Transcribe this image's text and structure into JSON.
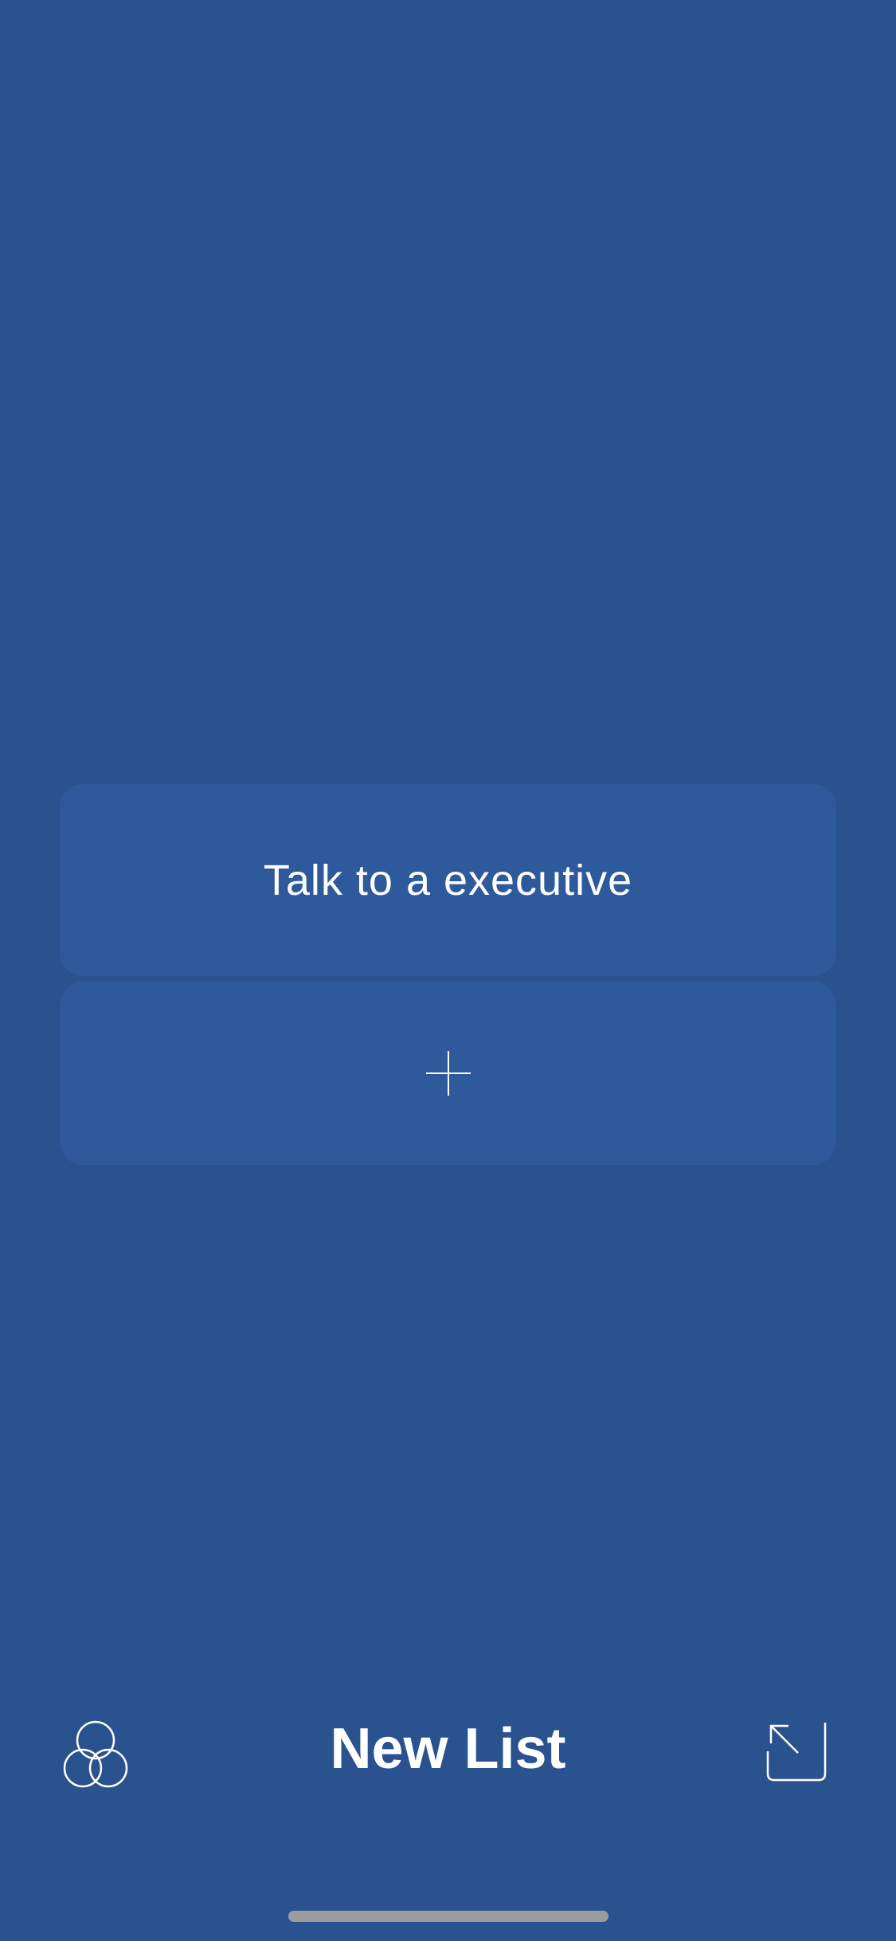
{
  "list": {
    "items": [
      {
        "label": "Talk to a executive"
      }
    ],
    "add_item_icon": "plus-icon"
  },
  "bottom_bar": {
    "title": "New List",
    "left_icon": "themes-icon",
    "right_icon": "expand-icon"
  },
  "colors": {
    "background": "#2a528f",
    "card": "#2e5a9c",
    "text": "#ffffff",
    "home_indicator": "#9c9c9c"
  }
}
